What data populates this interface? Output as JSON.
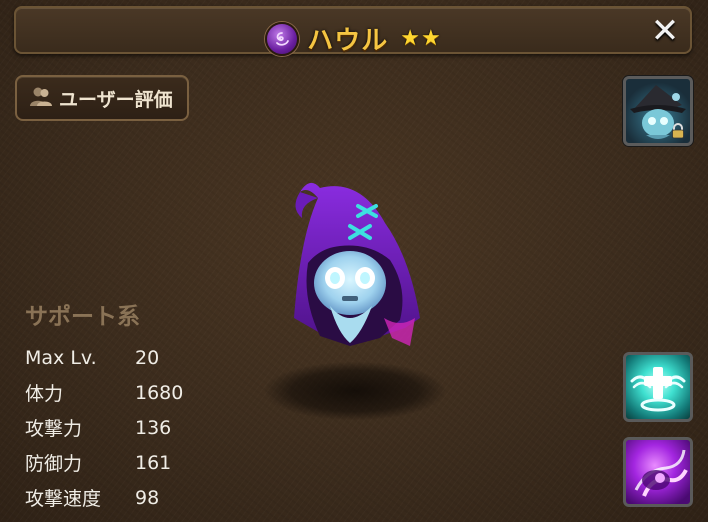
{
  "title": {
    "element_icon": "dark-element-icon",
    "name": "ハウル",
    "stars": 2,
    "star_glyph": "★"
  },
  "close_button": {
    "glyph": "✕"
  },
  "user_review_button": {
    "icon": "users-icon",
    "label": "ユーザー評価"
  },
  "monster": {
    "icon": "howl-ghost-monster"
  },
  "type_label": "サポート系",
  "stats": [
    {
      "label": "Max Lv.",
      "value": "20"
    },
    {
      "label": "体力",
      "value": "1680"
    },
    {
      "label": "攻撃力",
      "value": "136"
    },
    {
      "label": "防御力",
      "value": "161"
    },
    {
      "label": "攻撃速度",
      "value": "98"
    }
  ],
  "skin_button": {
    "icon": "locked-skin-icon"
  },
  "skills": [
    {
      "icon": "heal-skill-icon"
    },
    {
      "icon": "dark-attack-skill-icon"
    }
  ],
  "colors": {
    "title_gold": "#f5c542",
    "background": "#3c2c1d",
    "type_label": "#8a7356"
  }
}
